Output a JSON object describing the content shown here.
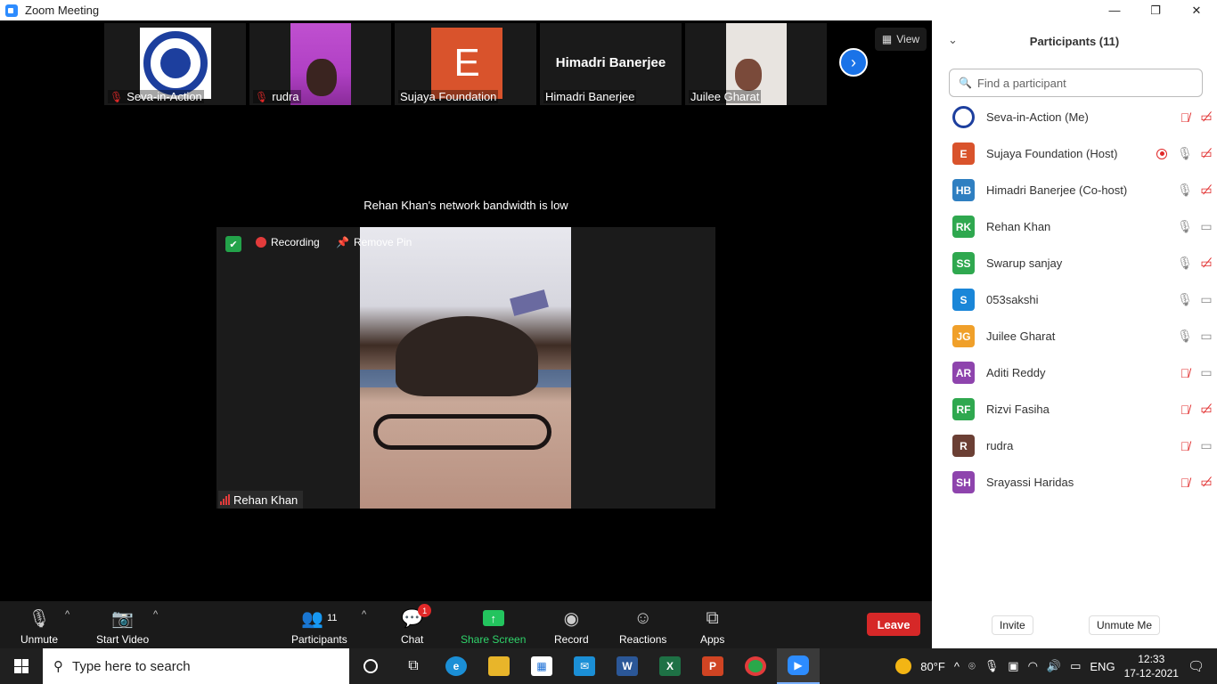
{
  "window": {
    "title": "Zoom Meeting",
    "controls": [
      "—",
      "❐",
      "✕"
    ]
  },
  "gallery_strip": [
    {
      "name": "Seva-in-Action",
      "muted": true,
      "kind": "logo"
    },
    {
      "name": "rudra",
      "muted": true,
      "kind": "camera"
    },
    {
      "name": "Sujaya Foundation",
      "muted": false,
      "kind": "avatar",
      "initial": "E"
    },
    {
      "name": "Himadri Banerjee",
      "muted": false,
      "kind": "name",
      "display": "Himadri Banerjee"
    },
    {
      "name": "Juilee Gharat",
      "muted": false,
      "kind": "camera"
    }
  ],
  "view_button": "View",
  "notice": "Rehan Khan's network bandwidth is low",
  "pinned": {
    "recording_label": "Recording",
    "remove_pin_label": "Remove Pin",
    "name": "Rehan Khan"
  },
  "toolbar": {
    "unmute": "Unmute",
    "start_video": "Start Video",
    "participants": "Participants",
    "participants_count": "11",
    "chat": "Chat",
    "chat_badge": "1",
    "share_screen": "Share Screen",
    "record": "Record",
    "reactions": "Reactions",
    "apps": "Apps",
    "leave": "Leave"
  },
  "panel": {
    "title": "Participants (11)",
    "search_placeholder": "Find a participant",
    "invite": "Invite",
    "unmute_me": "Unmute Me",
    "participants": [
      {
        "name": "Seva-in-Action (Me)",
        "initials": "",
        "color": "#ffffff",
        "mic": "muted",
        "video": "off",
        "recording": false,
        "logo": true
      },
      {
        "name": "Sujaya Foundation (Host)",
        "initials": "E",
        "color": "#d9532c",
        "mic": "on",
        "video": "off",
        "recording": true
      },
      {
        "name": "Himadri Banerjee (Co-host)",
        "initials": "HB",
        "color": "#2f7fc1",
        "mic": "on",
        "video": "off",
        "recording": false
      },
      {
        "name": "Rehan Khan",
        "initials": "RK",
        "color": "#2fa84f",
        "mic": "on",
        "video": "on",
        "recording": false
      },
      {
        "name": "Swarup sanjay",
        "initials": "SS",
        "color": "#2fa84f",
        "mic": "on",
        "video": "off",
        "recording": false
      },
      {
        "name": "053sakshi",
        "initials": "S",
        "color": "#1a86d8",
        "mic": "on",
        "video": "on",
        "recording": false
      },
      {
        "name": "Juilee Gharat",
        "initials": "JG",
        "color": "#f0a02a",
        "mic": "on",
        "video": "on",
        "recording": false
      },
      {
        "name": "Aditi Reddy",
        "initials": "AR",
        "color": "#8e44ad",
        "mic": "muted",
        "video": "on",
        "recording": false
      },
      {
        "name": "Rizvi Fasiha",
        "initials": "RF",
        "color": "#2fa84f",
        "mic": "muted",
        "video": "off",
        "recording": false
      },
      {
        "name": "rudra",
        "initials": "R",
        "color": "#6b3f34",
        "mic": "muted",
        "video": "on",
        "recording": false
      },
      {
        "name": "Srayassi Haridas",
        "initials": "SH",
        "color": "#8e44ad",
        "mic": "muted",
        "video": "off",
        "recording": false
      }
    ]
  },
  "taskbar": {
    "search_placeholder": "Type here to search",
    "weather": "80°F",
    "language": "ENG",
    "time": "12:33",
    "date": "17-12-2021"
  }
}
